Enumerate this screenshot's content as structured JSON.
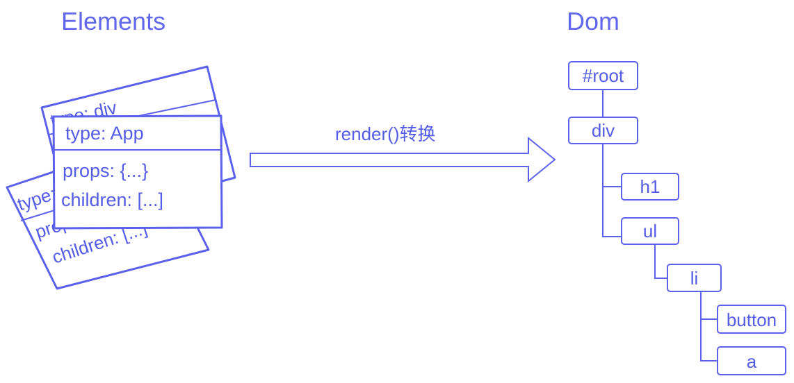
{
  "titles": {
    "left": "Elements",
    "right": "Dom"
  },
  "arrow": {
    "label": "render()转换"
  },
  "cards": {
    "back": {
      "type": "type: App",
      "props": "props: {...}",
      "children": "children: [...]"
    },
    "middle": {
      "type": "type: div"
    },
    "front": {
      "type": "type: App",
      "props": "props: {...}",
      "children": "children: [...]"
    }
  },
  "dom_tree": {
    "root": "#root",
    "div": "div",
    "h1": "h1",
    "ul": "ul",
    "li": "li",
    "button": "button",
    "a": "a"
  },
  "colors": {
    "accent": "#5b61ea",
    "text": "#555ce6",
    "background": "#ffffff"
  }
}
